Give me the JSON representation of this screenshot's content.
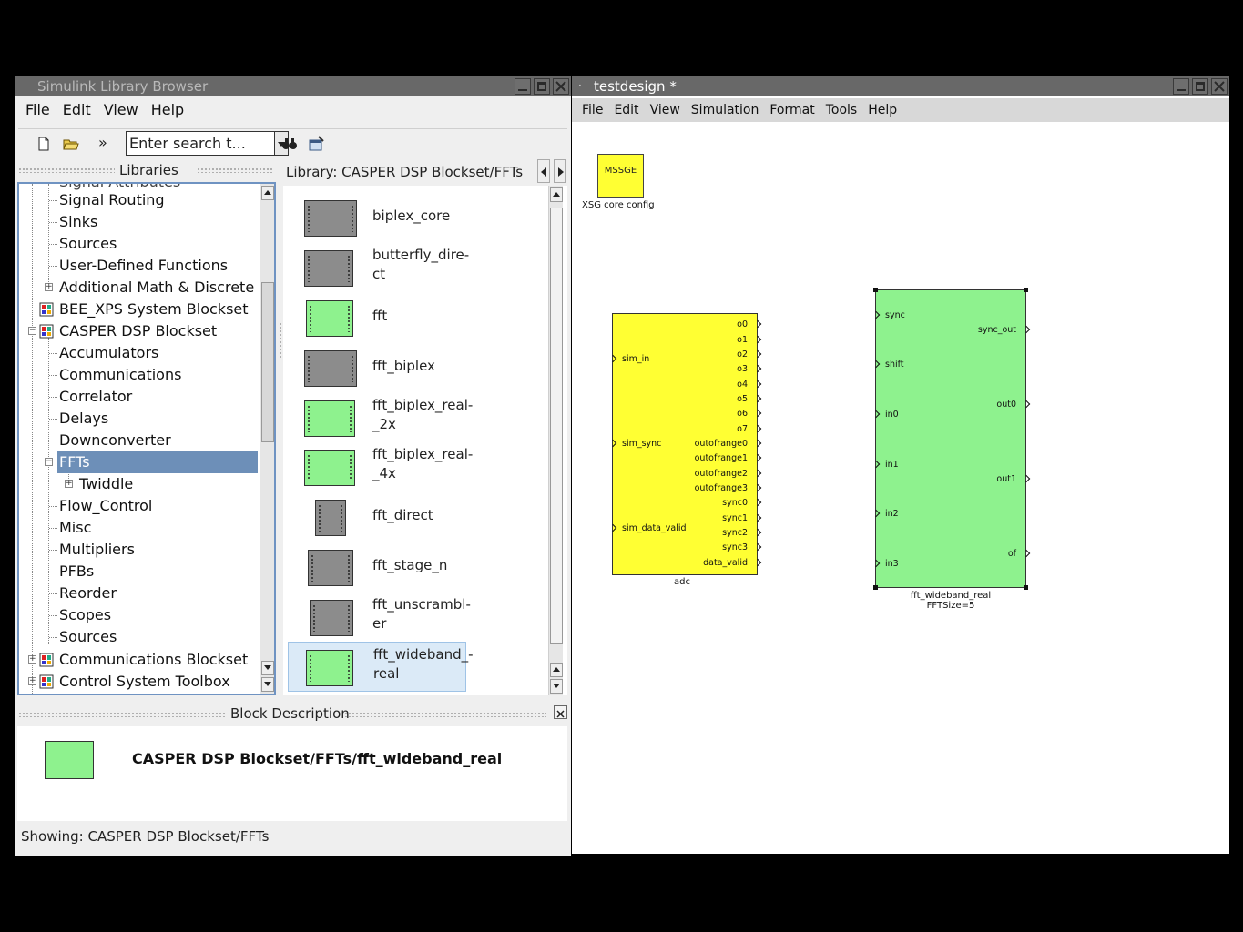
{
  "library_browser": {
    "title": "Simulink Library Browser",
    "menu": [
      "File",
      "Edit",
      "View",
      "Help"
    ],
    "search_placeholder": "Enter search t...",
    "libraries_header": "Libraries",
    "library_path": "Library: CASPER DSP Blockset/FFTs",
    "tree": {
      "partial_top": "Signal Attributes",
      "items": [
        {
          "label": "Signal Routing"
        },
        {
          "label": "Sinks"
        },
        {
          "label": "Sources"
        },
        {
          "label": "User-Defined Functions"
        },
        {
          "label": "Additional Math & Discrete"
        },
        {
          "label": "BEE_XPS System Blockset"
        },
        {
          "label": "CASPER DSP Blockset"
        },
        {
          "label": "Accumulators"
        },
        {
          "label": "Communications"
        },
        {
          "label": "Correlator"
        },
        {
          "label": "Delays"
        },
        {
          "label": "Downconverter"
        },
        {
          "label": "FFTs"
        },
        {
          "label": "Twiddle"
        },
        {
          "label": "Flow_Control"
        },
        {
          "label": "Misc"
        },
        {
          "label": "Multipliers"
        },
        {
          "label": "PFBs"
        },
        {
          "label": "Reorder"
        },
        {
          "label": "Scopes"
        },
        {
          "label": "Sources"
        },
        {
          "label": "Communications Blockset"
        },
        {
          "label": "Control System Toolbox"
        }
      ],
      "selected": "FFTs"
    },
    "blocks": [
      {
        "line1": "biplex_core",
        "line2": "",
        "color": "gray"
      },
      {
        "line1": "butterfly_dire-",
        "line2": "ct",
        "color": "gray"
      },
      {
        "line1": "fft",
        "line2": "",
        "color": "green"
      },
      {
        "line1": "fft_biplex",
        "line2": "",
        "color": "gray"
      },
      {
        "line1": "fft_biplex_real-",
        "line2": "_2x",
        "color": "green"
      },
      {
        "line1": "fft_biplex_real-",
        "line2": "_4x",
        "color": "green"
      },
      {
        "line1": "fft_direct",
        "line2": "",
        "color": "gray"
      },
      {
        "line1": "fft_stage_n",
        "line2": "",
        "color": "gray"
      },
      {
        "line1": "fft_unscrambl-",
        "line2": "er",
        "color": "gray"
      },
      {
        "line1": "fft_wideband_-",
        "line2": "real",
        "color": "green"
      }
    ],
    "selected_block": "fft_wideband_real",
    "block_description_header": "Block Description",
    "block_description_title": "CASPER DSP Blockset/FFTs/fft_wideband_real",
    "status": "Showing: CASPER DSP Blockset/FFTs"
  },
  "model": {
    "title": "testdesign *",
    "menu": [
      "File",
      "Edit",
      "View",
      "Simulation",
      "Format",
      "Tools",
      "Help"
    ],
    "xsg_block": {
      "label": "MSSGE",
      "caption": "XSG core config"
    },
    "adc_block": {
      "caption": "adc",
      "inputs": [
        "sim_in",
        "sim_sync",
        "sim_data_valid"
      ],
      "outputs": [
        "o0",
        "o1",
        "o2",
        "o3",
        "o4",
        "o5",
        "o6",
        "o7",
        "outofrange0",
        "outofrange1",
        "outofrange2",
        "outofrange3",
        "sync0",
        "sync1",
        "sync2",
        "sync3",
        "data_valid"
      ]
    },
    "fft_block": {
      "caption": "fft_wideband_real",
      "param": "FFTSize=5",
      "inputs": [
        "sync",
        "shift",
        "in0",
        "in1",
        "in2",
        "in3"
      ],
      "outputs": [
        "sync_out",
        "out0",
        "out1",
        "of"
      ]
    }
  },
  "colors": {
    "titlebar": "#686868",
    "selection": "#6d8fb8",
    "block_yellow": "#ffff33",
    "block_green": "#8ef28e",
    "block_gray": "#8c8c8c"
  }
}
